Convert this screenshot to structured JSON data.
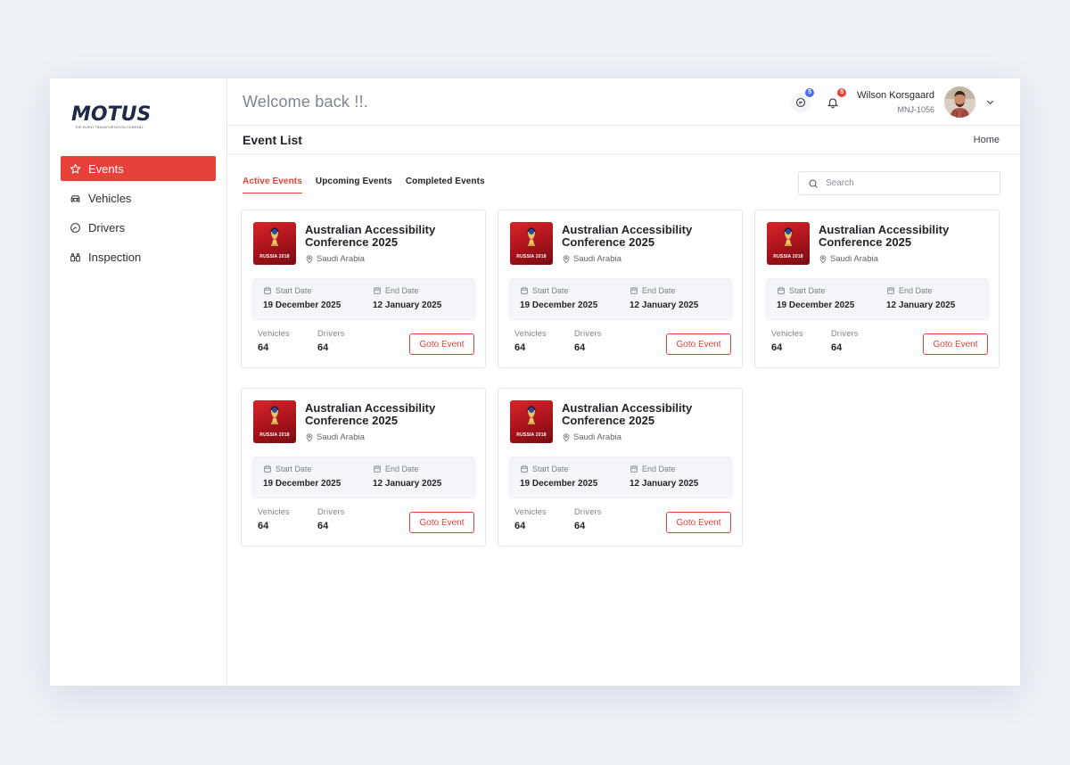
{
  "brand": {
    "logo_text": "MOTUS",
    "logo_subtitle": "THE EVENT TRANSPORTATION COMPANY"
  },
  "sidebar": {
    "items": [
      {
        "label": "Events",
        "icon": "star-icon",
        "active": true
      },
      {
        "label": "Vehicles",
        "icon": "car-icon",
        "active": false
      },
      {
        "label": "Drivers",
        "icon": "steering-wheel-icon",
        "active": false
      },
      {
        "label": "Inspection",
        "icon": "binoculars-icon",
        "active": false
      }
    ]
  },
  "header": {
    "welcome": "Welcome back !!.",
    "messages_count": "5",
    "notifications_count": "5",
    "user_name": "Wilson Korsgaard",
    "user_id": "MNJ-1056"
  },
  "page": {
    "title": "Event List",
    "breadcrumb": "Home"
  },
  "tabs": [
    {
      "label": "Active Events",
      "active": true
    },
    {
      "label": "Upcoming Events",
      "active": false
    },
    {
      "label": "Completed Events",
      "active": false
    }
  ],
  "search": {
    "placeholder": "Search"
  },
  "labels": {
    "start_date": "Start Date",
    "end_date": "End Date",
    "vehicles": "Vehicles",
    "drivers": "Drivers",
    "goto": "Goto Event",
    "thumb_text": "RUSSIA 2018"
  },
  "events": [
    {
      "title": "Australian Accessibility Conference 2025",
      "location": "Saudi Arabia",
      "start": "19 December 2025",
      "end": "12 January 2025",
      "vehicles": "64",
      "drivers": "64"
    },
    {
      "title": "Australian Accessibility Conference 2025",
      "location": "Saudi Arabia",
      "start": "19 December 2025",
      "end": "12 January 2025",
      "vehicles": "64",
      "drivers": "64"
    },
    {
      "title": "Australian Accessibility Conference 2025",
      "location": "Saudi Arabia",
      "start": "19 December 2025",
      "end": "12 January 2025",
      "vehicles": "64",
      "drivers": "64"
    },
    {
      "title": "Australian Accessibility Conference 2025",
      "location": "Saudi Arabia",
      "start": "19 December 2025",
      "end": "12 January 2025",
      "vehicles": "64",
      "drivers": "64"
    },
    {
      "title": "Australian Accessibility Conference 2025",
      "location": "Saudi Arabia",
      "start": "19 December 2025",
      "end": "12 January 2025",
      "vehicles": "64",
      "drivers": "64"
    }
  ],
  "colors": {
    "accent": "#e8413a",
    "brand_navy": "#1d2a4a",
    "badge_blue": "#4a6cf7"
  }
}
